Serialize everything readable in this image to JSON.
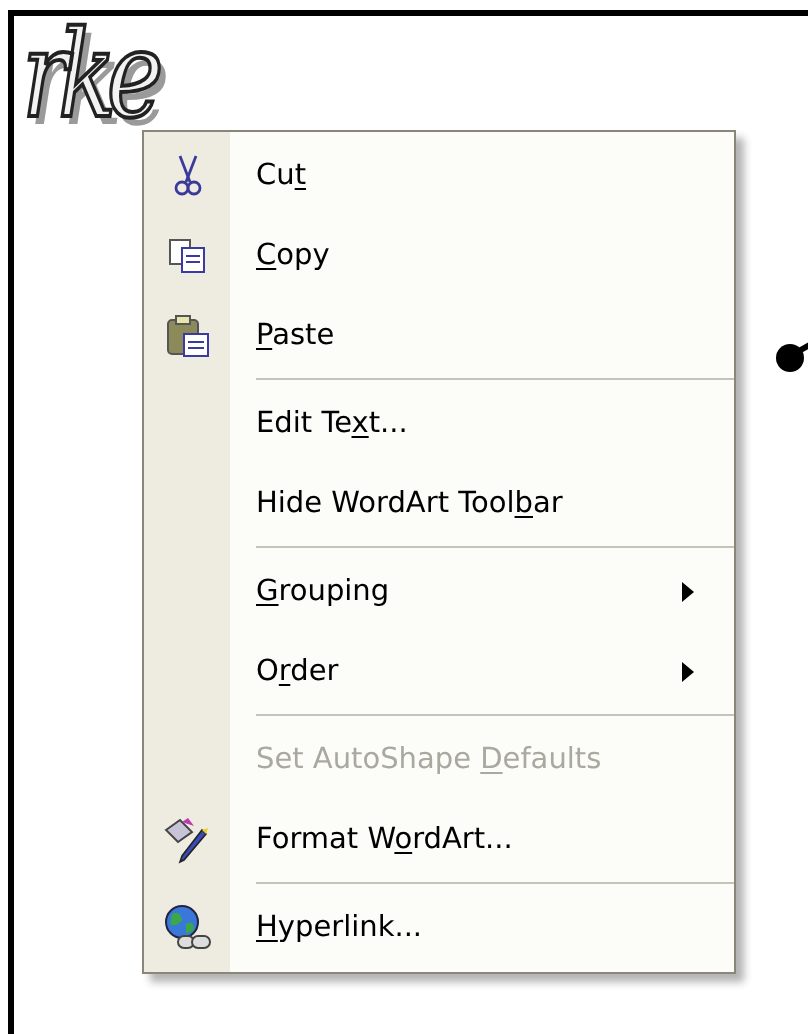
{
  "wordart": {
    "text": "rke"
  },
  "context_menu": {
    "groups": [
      [
        {
          "label_start": "Cu",
          "access_key": "t",
          "disabled": false,
          "submenu": false
        },
        {
          "access_key": "C",
          "label_end": "opy",
          "disabled": false,
          "submenu": false
        },
        {
          "access_key": "P",
          "label_end": "aste",
          "disabled": false,
          "submenu": false
        }
      ],
      [
        {
          "label_start": "Edit Te",
          "access_key": "x",
          "label_end": "t...",
          "disabled": false,
          "submenu": false
        },
        {
          "label_start": "Hide WordArt Tool",
          "access_key": "b",
          "label_end": "ar",
          "disabled": false,
          "submenu": false
        }
      ],
      [
        {
          "access_key": "G",
          "label_end": "rouping",
          "disabled": false,
          "submenu": true
        },
        {
          "label_start": "O",
          "access_key": "r",
          "label_end": "der",
          "disabled": false,
          "submenu": true
        }
      ],
      [
        {
          "label_start": "Set AutoShape ",
          "access_key": "D",
          "label_end": "efaults",
          "disabled": true,
          "submenu": false
        },
        {
          "label_start": "Format W",
          "access_key": "o",
          "label_end": "rdArt...",
          "disabled": false,
          "submenu": false
        }
      ],
      [
        {
          "access_key": "H",
          "label_end": "yperlink...",
          "disabled": false,
          "submenu": false
        }
      ]
    ]
  }
}
